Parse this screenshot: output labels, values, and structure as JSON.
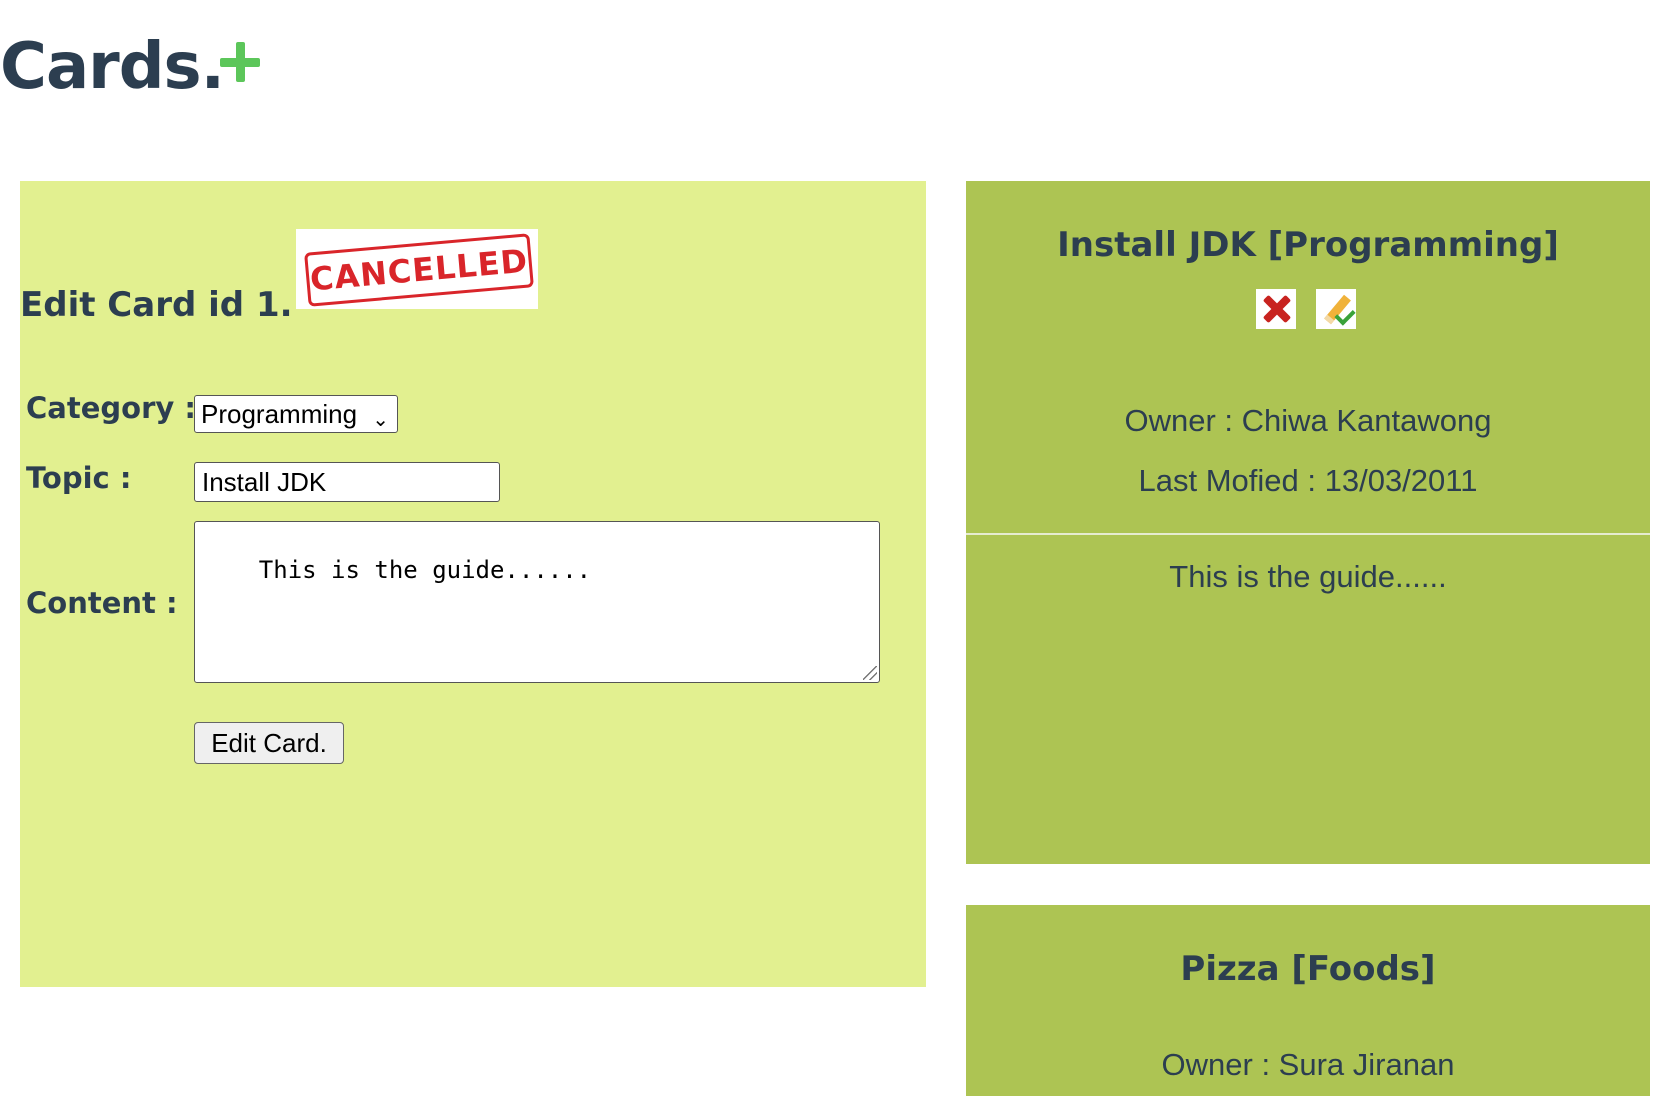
{
  "header": {
    "title": "Cards."
  },
  "edit_form": {
    "heading": "Edit Card id 1.",
    "stamp_text": "CANCELLED",
    "category_label": "Category :",
    "category_value": "Programming",
    "topic_label": "Topic :",
    "topic_value": "Install JDK",
    "content_label": "Content :",
    "content_value": "This is the guide......",
    "submit_label": "Edit Card."
  },
  "cards": [
    {
      "title": "Install JDK [Programming]",
      "owner": "Owner : Chiwa Kantawong",
      "modified": "Last Mofied : 13/03/2011",
      "content": "This is the guide......"
    },
    {
      "title": "Pizza [Foods]",
      "owner": "Owner : Sura Jiranan"
    }
  ],
  "colors": {
    "edit_panel_bg": "#e2f090",
    "card_bg": "#adc453",
    "add_icon": "#5cc65a",
    "text": "#2c3e50"
  },
  "icons": [
    "plus-icon",
    "delete-icon",
    "edit-icon",
    "chevron-down-icon"
  ]
}
